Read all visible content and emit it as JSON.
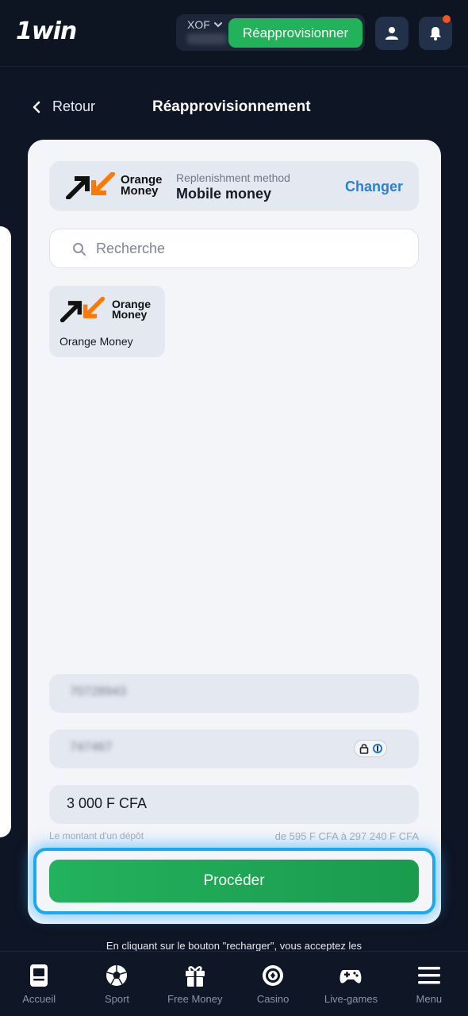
{
  "header": {
    "logo": "1win",
    "currency": "XOF",
    "balance": "0,00",
    "topup_label": "Réapprovisionner"
  },
  "titlebar": {
    "back_label": "Retour",
    "title": "Réapprovisionnement"
  },
  "method": {
    "logo_text_line1": "Orange",
    "logo_text_line2": "Money",
    "label": "Replenishment method",
    "value": "Mobile money",
    "change_label": "Changer"
  },
  "search": {
    "placeholder": "Recherche"
  },
  "methods_list": [
    {
      "name": "Orange Money",
      "logo_line1": "Orange",
      "logo_line2": "Money"
    }
  ],
  "form": {
    "phone_value": "70728943",
    "code_value": "747467",
    "amount_value": "3 000 F CFA",
    "amount_hint": "Le montant d'un dépôt",
    "amount_range": "de 595 F CFA à 297 240 F CFA",
    "proceed_label": "Procéder"
  },
  "terms_text": "En cliquant sur le bouton \"recharger\", vous acceptez les",
  "bottom_nav": [
    {
      "label": "Accueil",
      "icon": "home-icon"
    },
    {
      "label": "Sport",
      "icon": "soccer-ball-icon"
    },
    {
      "label": "Free Money",
      "icon": "gift-icon"
    },
    {
      "label": "Casino",
      "icon": "casino-chip-icon"
    },
    {
      "label": "Live-games",
      "icon": "gamepad-icon"
    },
    {
      "label": "Menu",
      "icon": "menu-icon"
    }
  ],
  "colors": {
    "accent_green": "#22b35a",
    "link_blue": "#2a7fd8",
    "highlight_blue": "#1aa8f0",
    "notification": "#f0561d",
    "orange_brand": "#ff7900"
  }
}
